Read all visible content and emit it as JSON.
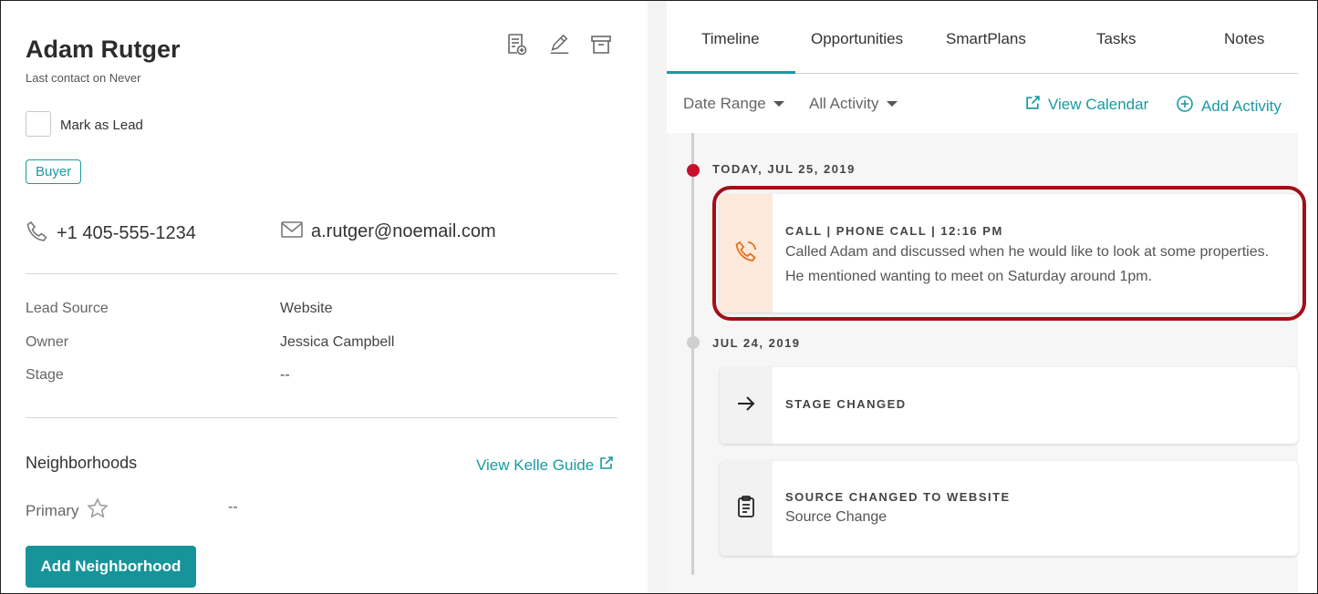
{
  "contact": {
    "name": "Adam Rutger",
    "last_contact": "Last contact on Never",
    "mark_as_lead_label": "Mark as Lead",
    "tag": "Buyer",
    "phone": "+1 405-555-1234",
    "email": "a.rutger@noemail.com"
  },
  "header_icons": [
    "new-document-icon",
    "edit-pencil-icon",
    "archive-icon"
  ],
  "fields": [
    {
      "label": "Lead Source",
      "value": "Website"
    },
    {
      "label": "Owner",
      "value": "Jessica Campbell"
    },
    {
      "label": "Stage",
      "value": "--"
    }
  ],
  "neighborhoods": {
    "title": "Neighborhoods",
    "guide_link": "View Kelle Guide",
    "primary_label": "Primary",
    "primary_value": "--",
    "add_button": "Add Neighborhood"
  },
  "tabs": [
    {
      "label": "Timeline",
      "active": true
    },
    {
      "label": "Opportunities",
      "active": false
    },
    {
      "label": "SmartPlans",
      "active": false
    },
    {
      "label": "Tasks",
      "active": false
    },
    {
      "label": "Notes",
      "active": false
    }
  ],
  "filters": {
    "date_range": "Date Range",
    "activity": "All Activity",
    "view_calendar": "View Calendar",
    "add_activity": "Add Activity"
  },
  "timeline": {
    "groups": [
      {
        "date": "TODAY, JUL 25, 2019",
        "dot_color": "#c8102e",
        "items": [
          {
            "title": "CALL | PHONE CALL | 12:16 PM",
            "body": "Called Adam and discussed when he would like to look at some properties. He mentioned wanting to meet on Saturday around 1pm.",
            "icon": "phone-icon",
            "icon_bg": "#fde9dc",
            "icon_color": "#e8701a",
            "highlighted": true
          }
        ]
      },
      {
        "date": "JUL 24, 2019",
        "dot_color": "#cfcfcf",
        "items": [
          {
            "title": "STAGE CHANGED",
            "body": "",
            "icon": "arrow-right-icon",
            "icon_bg": "#f2f2f2"
          },
          {
            "title": "SOURCE CHANGED TO WEBSITE",
            "body": "Source Change",
            "icon": "clipboard-icon",
            "icon_bg": "#f2f2f2"
          }
        ]
      }
    ]
  },
  "colors": {
    "accent": "#1a9aa0",
    "highlight_border": "#a30f18",
    "today_dot": "#c8102e"
  }
}
